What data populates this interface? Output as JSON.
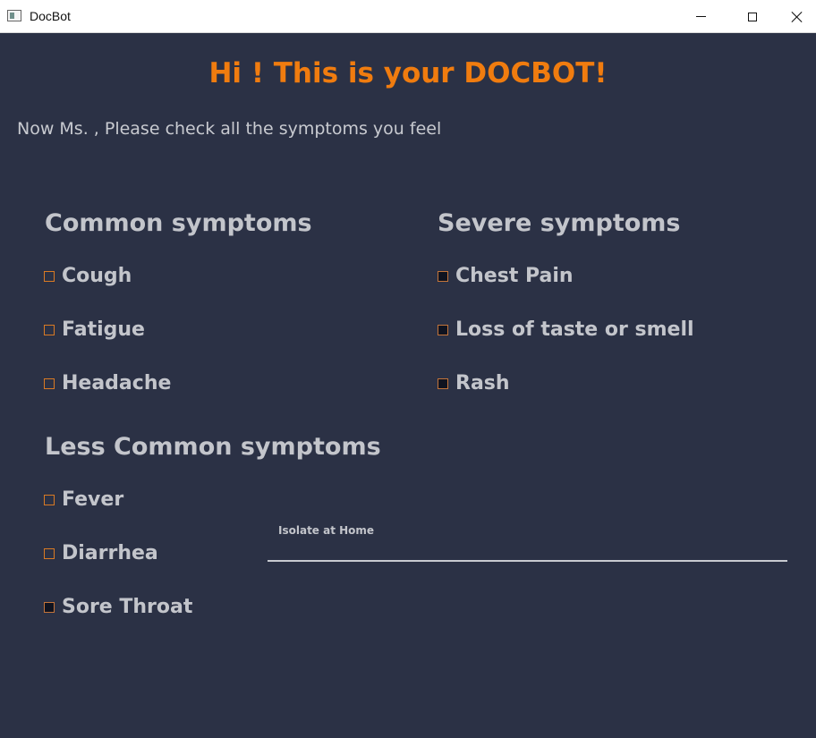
{
  "window": {
    "title": "DocBot",
    "app_icon": "window-app-icon",
    "controls": [
      "minimize-icon",
      "maximize-icon",
      "close-icon"
    ]
  },
  "heading": "Hi ! This is your DOCBOT!",
  "subtitle": "Now Ms. , Please check all the symptoms you feel",
  "sections": {
    "common": {
      "title": "Common symptoms",
      "items": [
        {
          "label": "Cough",
          "checked": false
        },
        {
          "label": "Fatigue",
          "checked": false
        },
        {
          "label": "Headache",
          "checked": false
        }
      ]
    },
    "severe": {
      "title": "Severe symptoms",
      "items": [
        {
          "label": "Chest Pain",
          "checked": false
        },
        {
          "label": "Loss of taste or smell",
          "checked": false
        },
        {
          "label": "Rash",
          "checked": false
        }
      ]
    },
    "less_common": {
      "title": "Less Common symptoms",
      "items": [
        {
          "label": "Fever",
          "checked": false
        },
        {
          "label": "Diarrhea",
          "checked": false
        },
        {
          "label": "Sore Throat",
          "checked": false
        }
      ]
    }
  },
  "result": {
    "label": "Isolate at Home",
    "value": ""
  },
  "colors": {
    "background": "#2b3145",
    "heading": "#f07c0f",
    "text": "#c3c5cb",
    "checkbox_border": "#d97a24"
  }
}
